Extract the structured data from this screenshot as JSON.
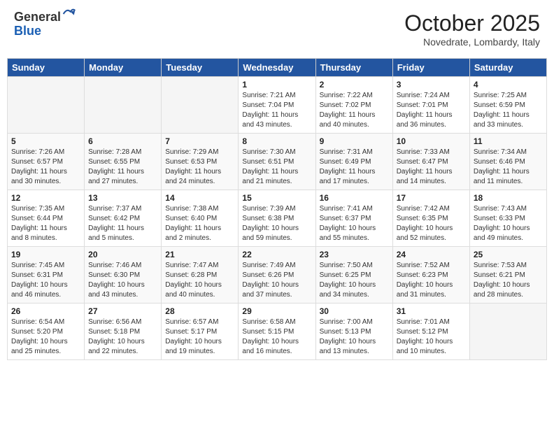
{
  "header": {
    "logo_general": "General",
    "logo_blue": "Blue",
    "month": "October 2025",
    "location": "Novedrate, Lombardy, Italy"
  },
  "days_of_week": [
    "Sunday",
    "Monday",
    "Tuesday",
    "Wednesday",
    "Thursday",
    "Friday",
    "Saturday"
  ],
  "weeks": [
    [
      {
        "day": null
      },
      {
        "day": null
      },
      {
        "day": null
      },
      {
        "day": "1",
        "sunrise": "Sunrise: 7:21 AM",
        "sunset": "Sunset: 7:04 PM",
        "daylight": "Daylight: 11 hours and 43 minutes."
      },
      {
        "day": "2",
        "sunrise": "Sunrise: 7:22 AM",
        "sunset": "Sunset: 7:02 PM",
        "daylight": "Daylight: 11 hours and 40 minutes."
      },
      {
        "day": "3",
        "sunrise": "Sunrise: 7:24 AM",
        "sunset": "Sunset: 7:01 PM",
        "daylight": "Daylight: 11 hours and 36 minutes."
      },
      {
        "day": "4",
        "sunrise": "Sunrise: 7:25 AM",
        "sunset": "Sunset: 6:59 PM",
        "daylight": "Daylight: 11 hours and 33 minutes."
      }
    ],
    [
      {
        "day": "5",
        "sunrise": "Sunrise: 7:26 AM",
        "sunset": "Sunset: 6:57 PM",
        "daylight": "Daylight: 11 hours and 30 minutes."
      },
      {
        "day": "6",
        "sunrise": "Sunrise: 7:28 AM",
        "sunset": "Sunset: 6:55 PM",
        "daylight": "Daylight: 11 hours and 27 minutes."
      },
      {
        "day": "7",
        "sunrise": "Sunrise: 7:29 AM",
        "sunset": "Sunset: 6:53 PM",
        "daylight": "Daylight: 11 hours and 24 minutes."
      },
      {
        "day": "8",
        "sunrise": "Sunrise: 7:30 AM",
        "sunset": "Sunset: 6:51 PM",
        "daylight": "Daylight: 11 hours and 21 minutes."
      },
      {
        "day": "9",
        "sunrise": "Sunrise: 7:31 AM",
        "sunset": "Sunset: 6:49 PM",
        "daylight": "Daylight: 11 hours and 17 minutes."
      },
      {
        "day": "10",
        "sunrise": "Sunrise: 7:33 AM",
        "sunset": "Sunset: 6:47 PM",
        "daylight": "Daylight: 11 hours and 14 minutes."
      },
      {
        "day": "11",
        "sunrise": "Sunrise: 7:34 AM",
        "sunset": "Sunset: 6:46 PM",
        "daylight": "Daylight: 11 hours and 11 minutes."
      }
    ],
    [
      {
        "day": "12",
        "sunrise": "Sunrise: 7:35 AM",
        "sunset": "Sunset: 6:44 PM",
        "daylight": "Daylight: 11 hours and 8 minutes."
      },
      {
        "day": "13",
        "sunrise": "Sunrise: 7:37 AM",
        "sunset": "Sunset: 6:42 PM",
        "daylight": "Daylight: 11 hours and 5 minutes."
      },
      {
        "day": "14",
        "sunrise": "Sunrise: 7:38 AM",
        "sunset": "Sunset: 6:40 PM",
        "daylight": "Daylight: 11 hours and 2 minutes."
      },
      {
        "day": "15",
        "sunrise": "Sunrise: 7:39 AM",
        "sunset": "Sunset: 6:38 PM",
        "daylight": "Daylight: 10 hours and 59 minutes."
      },
      {
        "day": "16",
        "sunrise": "Sunrise: 7:41 AM",
        "sunset": "Sunset: 6:37 PM",
        "daylight": "Daylight: 10 hours and 55 minutes."
      },
      {
        "day": "17",
        "sunrise": "Sunrise: 7:42 AM",
        "sunset": "Sunset: 6:35 PM",
        "daylight": "Daylight: 10 hours and 52 minutes."
      },
      {
        "day": "18",
        "sunrise": "Sunrise: 7:43 AM",
        "sunset": "Sunset: 6:33 PM",
        "daylight": "Daylight: 10 hours and 49 minutes."
      }
    ],
    [
      {
        "day": "19",
        "sunrise": "Sunrise: 7:45 AM",
        "sunset": "Sunset: 6:31 PM",
        "daylight": "Daylight: 10 hours and 46 minutes."
      },
      {
        "day": "20",
        "sunrise": "Sunrise: 7:46 AM",
        "sunset": "Sunset: 6:30 PM",
        "daylight": "Daylight: 10 hours and 43 minutes."
      },
      {
        "day": "21",
        "sunrise": "Sunrise: 7:47 AM",
        "sunset": "Sunset: 6:28 PM",
        "daylight": "Daylight: 10 hours and 40 minutes."
      },
      {
        "day": "22",
        "sunrise": "Sunrise: 7:49 AM",
        "sunset": "Sunset: 6:26 PM",
        "daylight": "Daylight: 10 hours and 37 minutes."
      },
      {
        "day": "23",
        "sunrise": "Sunrise: 7:50 AM",
        "sunset": "Sunset: 6:25 PM",
        "daylight": "Daylight: 10 hours and 34 minutes."
      },
      {
        "day": "24",
        "sunrise": "Sunrise: 7:52 AM",
        "sunset": "Sunset: 6:23 PM",
        "daylight": "Daylight: 10 hours and 31 minutes."
      },
      {
        "day": "25",
        "sunrise": "Sunrise: 7:53 AM",
        "sunset": "Sunset: 6:21 PM",
        "daylight": "Daylight: 10 hours and 28 minutes."
      }
    ],
    [
      {
        "day": "26",
        "sunrise": "Sunrise: 6:54 AM",
        "sunset": "Sunset: 5:20 PM",
        "daylight": "Daylight: 10 hours and 25 minutes."
      },
      {
        "day": "27",
        "sunrise": "Sunrise: 6:56 AM",
        "sunset": "Sunset: 5:18 PM",
        "daylight": "Daylight: 10 hours and 22 minutes."
      },
      {
        "day": "28",
        "sunrise": "Sunrise: 6:57 AM",
        "sunset": "Sunset: 5:17 PM",
        "daylight": "Daylight: 10 hours and 19 minutes."
      },
      {
        "day": "29",
        "sunrise": "Sunrise: 6:58 AM",
        "sunset": "Sunset: 5:15 PM",
        "daylight": "Daylight: 10 hours and 16 minutes."
      },
      {
        "day": "30",
        "sunrise": "Sunrise: 7:00 AM",
        "sunset": "Sunset: 5:13 PM",
        "daylight": "Daylight: 10 hours and 13 minutes."
      },
      {
        "day": "31",
        "sunrise": "Sunrise: 7:01 AM",
        "sunset": "Sunset: 5:12 PM",
        "daylight": "Daylight: 10 hours and 10 minutes."
      },
      {
        "day": null
      }
    ]
  ]
}
